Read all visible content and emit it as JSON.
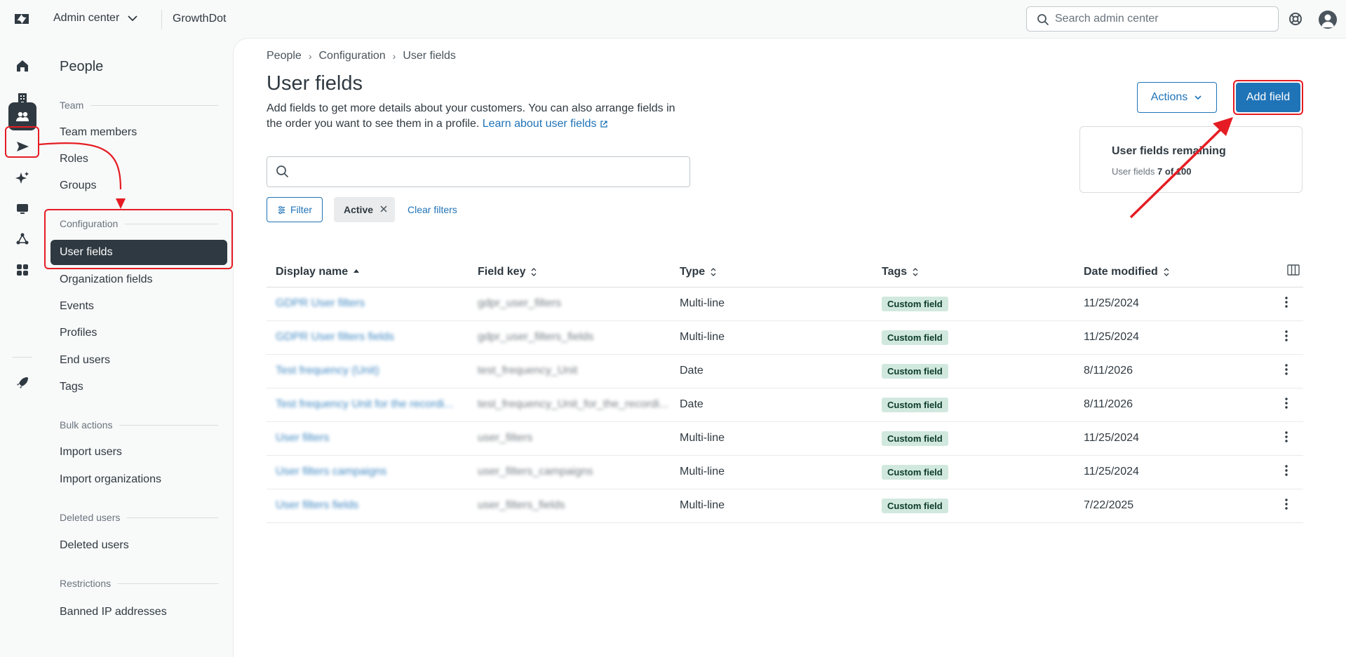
{
  "topbar": {
    "product": "Admin center",
    "brand": "GrowthDot",
    "search_placeholder": "Search admin center"
  },
  "sidebar": {
    "title": "People",
    "sections": {
      "team": "Team",
      "configuration": "Configuration",
      "bulk": "Bulk actions",
      "deleted": "Deleted users",
      "restrictions": "Restrictions"
    },
    "items": {
      "team_members": "Team members",
      "roles": "Roles",
      "groups": "Groups",
      "user_fields": "User fields",
      "org_fields": "Organization fields",
      "events": "Events",
      "profiles": "Profiles",
      "end_users": "End users",
      "tags": "Tags",
      "import_users": "Import users",
      "import_orgs": "Import organizations",
      "deleted_users": "Deleted users",
      "banned_ip": "Banned IP addresses"
    }
  },
  "breadcrumb": [
    "People",
    "Configuration",
    "User fields"
  ],
  "page": {
    "title": "User fields",
    "description": "Add fields to get more details about your customers. You can also arrange fields in the order you want to see them in a profile.",
    "learn_link": "Learn about user fields",
    "actions_label": "Actions",
    "add_label": "Add field",
    "remaining_title": "User fields remaining",
    "remaining_label": "User fields",
    "remaining_count": "7 of 100"
  },
  "filters": {
    "filter_label": "Filter",
    "chip_active": "Active",
    "clear_label": "Clear filters"
  },
  "table": {
    "headers": [
      "Display name",
      "Field key",
      "Type",
      "Tags",
      "Date modified"
    ],
    "rows": [
      {
        "name": "GDPR User filters",
        "key": "gdpr_user_filters",
        "type": "Multi-line",
        "tag": "Custom field",
        "date": "11/25/2024"
      },
      {
        "name": "GDPR User filters fields",
        "key": "gdpr_user_filters_fields",
        "type": "Multi-line",
        "tag": "Custom field",
        "date": "11/25/2024"
      },
      {
        "name": "Test frequency (Unit)",
        "key": "test_frequency_Unit",
        "type": "Date",
        "tag": "Custom field",
        "date": "8/11/2026"
      },
      {
        "name": "Test frequency Unit for the recordi...",
        "key": "test_frequency_Unit_for_the_recordi...",
        "type": "Date",
        "tag": "Custom field",
        "date": "8/11/2026"
      },
      {
        "name": "User filters",
        "key": "user_filters",
        "type": "Multi-line",
        "tag": "Custom field",
        "date": "11/25/2024"
      },
      {
        "name": "User filters campaigns",
        "key": "user_filters_campaigns",
        "type": "Multi-line",
        "tag": "Custom field",
        "date": "11/25/2024"
      },
      {
        "name": "User filters fields",
        "key": "user_filters_fields",
        "type": "Multi-line",
        "tag": "Custom field",
        "date": "7/22/2025"
      }
    ]
  },
  "colors": {
    "accent": "#1f73b7",
    "annotation": "#e51c23",
    "tag_bg": "#d1e8df"
  }
}
